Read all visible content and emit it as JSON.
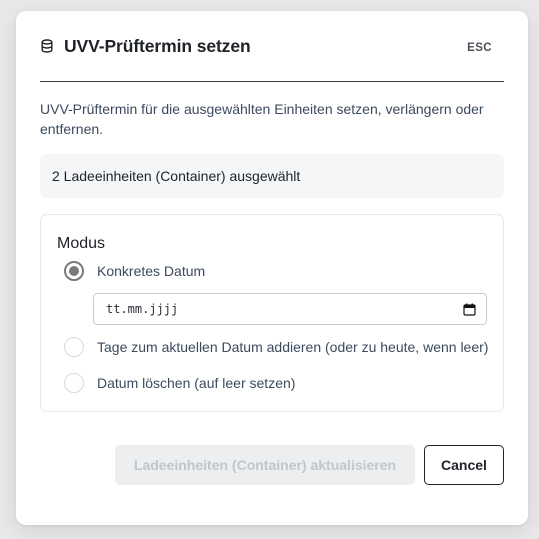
{
  "dialog": {
    "title": "UVV-Prüftermin setzen",
    "title_icon": "database-icon",
    "close_hint": "ESC",
    "description": "UVV-Prüftermin für die ausgewählten Einheiten setzen, verlängern oder entfernen.",
    "selection_summary": "2 Ladeeinheiten (Container) ausgewählt"
  },
  "mode": {
    "legend": "Modus",
    "options": [
      {
        "label": "Konkretes Datum",
        "checked": true
      },
      {
        "label": "Tage zum aktuellen Datum addieren (oder zu heute, wenn leer)",
        "checked": false
      },
      {
        "label": "Datum löschen (auf leer setzen)",
        "checked": false
      }
    ],
    "date_input": {
      "placeholder": "tt.mm.jjjj",
      "icon": "calendar-icon"
    }
  },
  "footer": {
    "submit_label": "Ladeeinheiten (Container) aktualisieren",
    "submit_disabled": true,
    "cancel_label": "Cancel"
  },
  "colors": {
    "title_text": "#1f2329",
    "body_text": "#3c4a5e",
    "disabled_button_bg": "#eceeef",
    "disabled_button_text": "#c2c6cc",
    "radio_checked": "#7a7a7a"
  }
}
